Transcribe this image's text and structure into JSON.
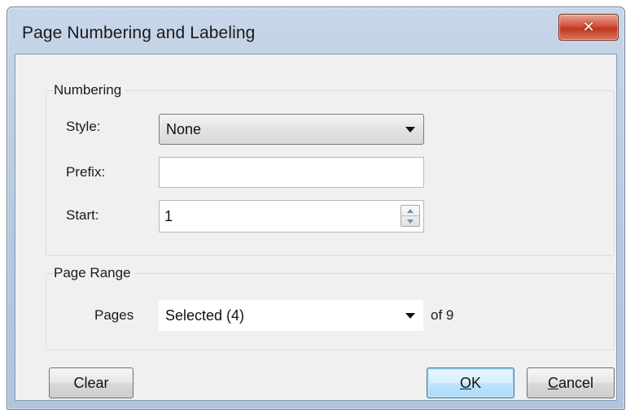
{
  "window": {
    "title": "Page Numbering and Labeling",
    "close_icon": "close-icon"
  },
  "numbering": {
    "group_label": "Numbering",
    "style_label": "Style:",
    "style_value": "None",
    "prefix_label": "Prefix:",
    "prefix_value": "",
    "start_label": "Start:",
    "start_value": "1"
  },
  "page_range": {
    "group_label": "Page Range",
    "pages_label": "Pages",
    "pages_value": "Selected (4)",
    "of_total": "of 9"
  },
  "buttons": {
    "clear": "Clear",
    "ok_underlined": "O",
    "ok_rest": "K",
    "cancel_underlined": "C",
    "cancel_rest": "ancel"
  },
  "colors": {
    "close_button": "#c0361f",
    "default_button_border": "#3c7fb1",
    "client_background": "#f0f0f0"
  }
}
